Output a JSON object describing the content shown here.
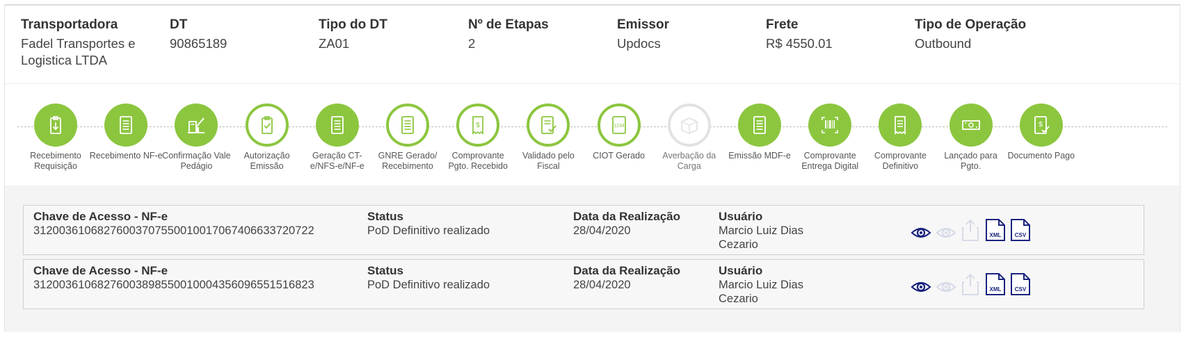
{
  "header": {
    "fields": [
      {
        "label": "Transportadora",
        "value": "Fadel Transportes e Logistica LTDA"
      },
      {
        "label": "DT",
        "value": "90865189"
      },
      {
        "label": "Tipo do DT",
        "value": "ZA01"
      },
      {
        "label": "Nº de Etapas",
        "value": "2"
      },
      {
        "label": "Emissor",
        "value": "Updocs"
      },
      {
        "label": "Frete",
        "value": "R$ 4550.01"
      },
      {
        "label": "Tipo de Operação",
        "value": "Outbound"
      }
    ]
  },
  "colors": {
    "step_green": "#8cc63f",
    "step_disabled": "#e2e2e2",
    "action_blue": "#1a237e",
    "action_disabled": "#d7dbe8"
  },
  "steps": [
    {
      "label": "Recebimento Requisição",
      "state": "filled",
      "icon": "clipboard-download-icon"
    },
    {
      "label": "Recebimento NF-e",
      "state": "filled",
      "icon": "document-lines-icon"
    },
    {
      "label": "Confirmação Vale Pedágio",
      "state": "filled",
      "icon": "toll-booth-icon"
    },
    {
      "label": "Autorização Emissão",
      "state": "outline",
      "icon": "clipboard-check-icon"
    },
    {
      "label": "Geração CT-e/NFS-e/NF-e",
      "state": "filled",
      "icon": "document-lines-icon"
    },
    {
      "label": "GNRE Gerado/ Recebimento",
      "state": "outline",
      "icon": "document-lines-icon"
    },
    {
      "label": "Comprovante Pgto. Recebido",
      "state": "outline",
      "icon": "receipt-dollar-icon"
    },
    {
      "label": "Validado pelo Fiscal",
      "state": "outline",
      "icon": "document-check-icon"
    },
    {
      "label": "CIOT Gerado",
      "state": "outline",
      "icon": "number-doc-icon"
    },
    {
      "label": "Averbação da Carga",
      "state": "disabled",
      "icon": "box-icon"
    },
    {
      "label": "Emissão MDF-e",
      "state": "filled",
      "icon": "document-lines-icon"
    },
    {
      "label": "Comprovante Entrega Digital",
      "state": "filled",
      "icon": "barcode-icon"
    },
    {
      "label": "Comprovante Definitivo",
      "state": "filled",
      "icon": "receipt-icon"
    },
    {
      "label": "Lançado para Pgto.",
      "state": "filled",
      "icon": "banknote-icon"
    },
    {
      "label": "Documento Pago",
      "state": "filled",
      "icon": "dollar-doc-check-icon"
    }
  ],
  "table": {
    "headers": {
      "chave": "Chave de Acesso - NF-e",
      "status": "Status",
      "data": "Data da Realização",
      "usuario": "Usuário"
    },
    "rows": [
      {
        "chave": "31200361068276003707550010017067406633720722",
        "status": "PoD Definitivo realizado",
        "data": "28/04/2020",
        "usuario": "Marcio Luiz Dias Cezario"
      },
      {
        "chave": "31200361068276003898550010004356096551516823",
        "status": "PoD Definitivo realizado",
        "data": "28/04/2020",
        "usuario": "Marcio Luiz Dias Cezario"
      }
    ],
    "actions": {
      "view_icon": "eye-icon",
      "view_disabled_icon": "eye-disabled-icon",
      "upload_icon": "upload-icon",
      "xml_label": "XML",
      "csv_label": "CSV"
    }
  }
}
